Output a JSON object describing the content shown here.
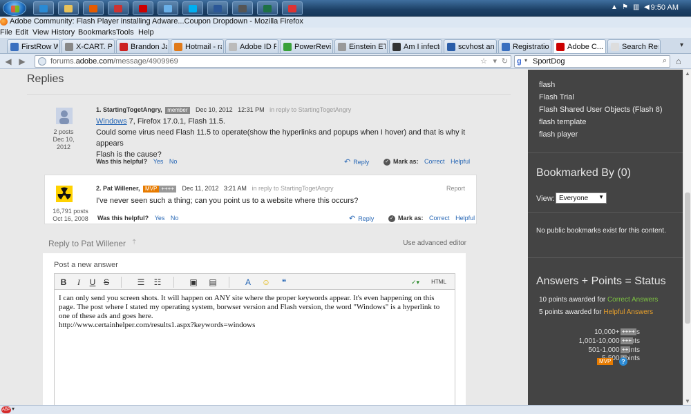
{
  "taskbar": {
    "clock": "9:50 AM",
    "pinned": [
      {
        "name": "ie-icon",
        "color": "#2a8ad4"
      },
      {
        "name": "folder-icon",
        "color": "#e8c25a"
      },
      {
        "name": "firefox-icon",
        "color": "#e55b00"
      },
      {
        "name": "app-icon-red",
        "color": "#c33"
      },
      {
        "name": "acrobat-icon",
        "color": "#c00"
      },
      {
        "name": "monitor-icon",
        "color": "#6ab0e8"
      },
      {
        "name": "skype-icon",
        "color": "#00aff0"
      },
      {
        "name": "word-icon",
        "color": "#2b5797"
      },
      {
        "name": "terminal-icon",
        "color": "#555"
      },
      {
        "name": "excel-icon",
        "color": "#1e7145"
      },
      {
        "name": "paint-icon",
        "color": "#d33"
      }
    ]
  },
  "window": {
    "title": "Adobe Community: Flash Player installing Adware...Coupon Dropdown - Mozilla Firefox"
  },
  "menu": [
    "File",
    "Edit",
    "View",
    "History",
    "Bookmarks",
    "Tools",
    "Help"
  ],
  "tabs": [
    {
      "label": "FirstRow W...",
      "color": "#3a6fbf"
    },
    {
      "label": "X-CART. Po...",
      "color": "#888"
    },
    {
      "label": "Brandon Jac...",
      "color": "#c22"
    },
    {
      "label": "Hotmail - ra...",
      "color": "#e07a1a"
    },
    {
      "label": "Adobe ID Pr...",
      "color": "#bbb"
    },
    {
      "label": "PowerRevie...",
      "color": "#3aa13a"
    },
    {
      "label": "Einstein ET-...",
      "color": "#999"
    },
    {
      "label": "Am I infecte...",
      "color": "#333"
    },
    {
      "label": "scvhost and...",
      "color": "#2a5da8"
    },
    {
      "label": "Registration...",
      "color": "#3a6fbf"
    },
    {
      "label": "Adobe C...",
      "color": "#c00"
    },
    {
      "label": "Search Resu...",
      "color": "#ddd"
    }
  ],
  "nav": {
    "url_prefix": "forums.",
    "url_host": "adobe.com",
    "url_path": "/message/4909969",
    "search_engine": "g",
    "search_text": "SportDog"
  },
  "thread": {
    "heading": "Replies",
    "replies": [
      {
        "number_name": "1. StartingTogetAngry,",
        "badge": "member",
        "date": "Dec 10, 2012",
        "time": "12:31 PM",
        "in_reply": "in reply to StartingTogetAngry",
        "posts": "2 posts",
        "joined_1": "Dec 10,",
        "joined_2": "2012",
        "link_word": "Windows",
        "line1_rest": " 7, Firefox 17.0.1, Flash 11.5.",
        "line2": "Could some virus need Flash 11.5 to operate(show the hyperlinks and popups when I hover) and that is why it appears",
        "line3": "Flash is the cause?"
      },
      {
        "number_name": "2. Pat Willener,",
        "badge": "MVP",
        "points_badge": "++++",
        "date": "Dec 11, 2012",
        "time": "3:21 AM",
        "in_reply": "in reply to StartingTogetAngry",
        "posts": "16,791 posts",
        "joined": "Oct 16, 2008",
        "report": "Report",
        "body": "I've never seen such a thing; can you point us to a website where this occurs?"
      }
    ],
    "was_helpful": "Was this helpful?",
    "yes": "Yes",
    "no": "No",
    "reply": "Reply",
    "mark_as": "Mark as:",
    "correct": "Correct",
    "helpful": "Helpful"
  },
  "editor": {
    "reply_to": "Reply to Pat Willener",
    "advanced": "Use advanced editor",
    "post_label": "Post a new answer",
    "html_label": "HTML",
    "content": "I can only send you screen shots. It will happen on ANY site where the proper keywords appear. It's even happening on this page. The post where I stated my operating system, borwser version and Flash version, the word \"Windows\" is a hyperlink to one of these ads and goes here.\nhttp://www.certainhelper.com/results1.aspx?keywords=windows"
  },
  "sidebar": {
    "tags": [
      "flash",
      "Flash Trial",
      "Flash Shared User Objects (Flash 8)",
      "flash template",
      "flash player"
    ],
    "bookmarked_heading": "Bookmarked By (0)",
    "view_label": "View:",
    "view_value": "Everyone",
    "no_bookmarks": "No public bookmarks exist for this content.",
    "status_heading": "Answers + Points = Status",
    "award1_pre": "10 points awarded for ",
    "award1_link": "Correct Answers",
    "award2_pre": "5 points awarded for ",
    "award2_link": "Helpful Answers",
    "levels": [
      {
        "label": "10,000+ points",
        "badge": "++++"
      },
      {
        "label": "1,001-10,000 points",
        "badge": "+++"
      },
      {
        "label": "501-1,000 points",
        "badge": "++"
      },
      {
        "label": "5-500 points",
        "badge": "+"
      }
    ],
    "mvp": "MVP",
    "help": "?"
  },
  "statusbar": {
    "abp": "ABP"
  }
}
